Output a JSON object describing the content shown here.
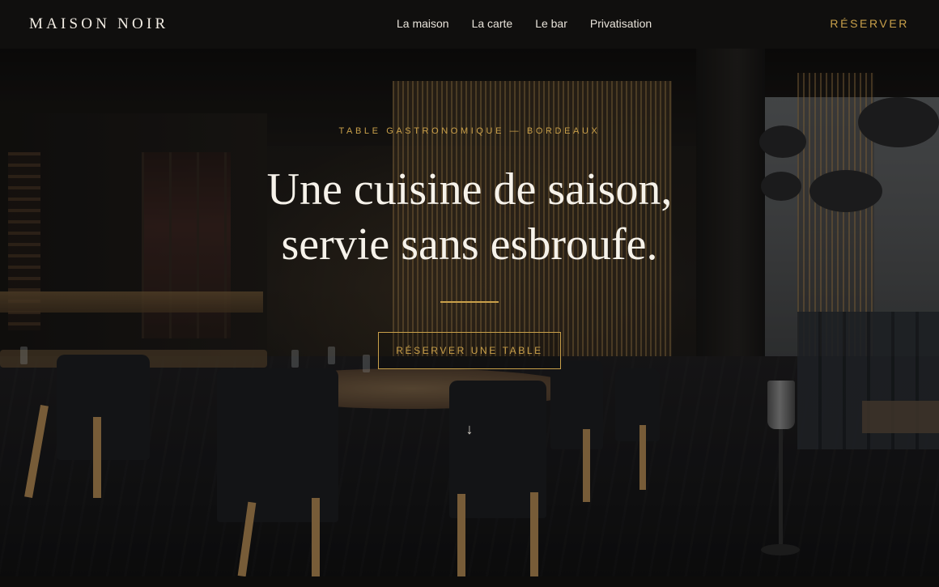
{
  "header": {
    "brand": "MAISON NOIR",
    "nav": [
      "La maison",
      "La carte",
      "Le bar",
      "Privatisation"
    ],
    "cta": "RÉSERVER"
  },
  "hero": {
    "eyebrow": "TABLE GASTRONOMIQUE — BORDEAUX",
    "headline_line1": "Une cuisine de saison,",
    "headline_line2": "servie sans esbroufe.",
    "cta": "RÉSERVER UNE TABLE",
    "scroll_icon": "arrow-down-icon",
    "scroll_glyph": "↓",
    "background_image": "restaurant dining room with wooden chairs and slatted partitions"
  },
  "colors": {
    "accent_gold": "#c9a04a",
    "header_bg": "#100f0e",
    "text_light": "#f6f2ea"
  }
}
